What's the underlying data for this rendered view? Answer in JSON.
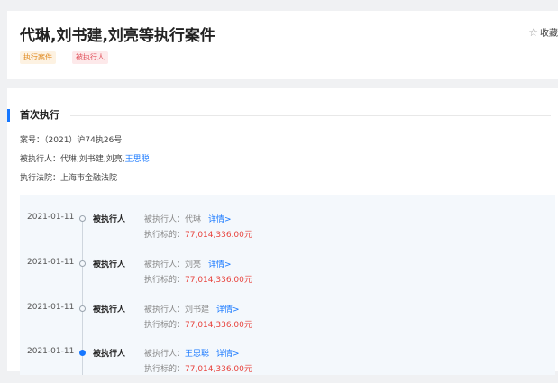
{
  "header": {
    "title": "代琳,刘书建,刘亮等执行案件",
    "favorite_label": "收藏",
    "tags": [
      "执行案件",
      "被执行人"
    ]
  },
  "section": {
    "title": "首次执行",
    "case_no_label": "案号：",
    "case_no": "（2021）沪74执26号",
    "executed_label": "被执行人：",
    "executed_names": "代琳,刘书建,刘亮,",
    "executed_highlight": "王思聪",
    "court_label": "执行法院：",
    "court": "上海市金融法院"
  },
  "timeline": {
    "executed_label": "被执行人：",
    "amount_label": "执行标的：",
    "detail_label": "详情>",
    "currency": "元",
    "items": [
      {
        "date": "2021-01-11",
        "type": "被执行人",
        "name": "代琳",
        "amount": "77,014,336.00",
        "active": false
      },
      {
        "date": "2021-01-11",
        "type": "被执行人",
        "name": "刘亮",
        "amount": "77,014,336.00",
        "active": false
      },
      {
        "date": "2021-01-11",
        "type": "被执行人",
        "name": "刘书建",
        "amount": "77,014,336.00",
        "active": false
      },
      {
        "date": "2021-01-11",
        "type": "被执行人",
        "name": "王思聪",
        "amount": "77,014,336.00",
        "active": true
      }
    ]
  },
  "colors": {
    "accent": "#1677ff",
    "amount": "#e8423c",
    "tag_case_bg": "#fdf2e2",
    "tag_case_text": "#e08a20",
    "tag_person_bg": "#fde9ea",
    "tag_person_text": "#e0505a"
  },
  "icons": {
    "favorite": "star-icon"
  }
}
